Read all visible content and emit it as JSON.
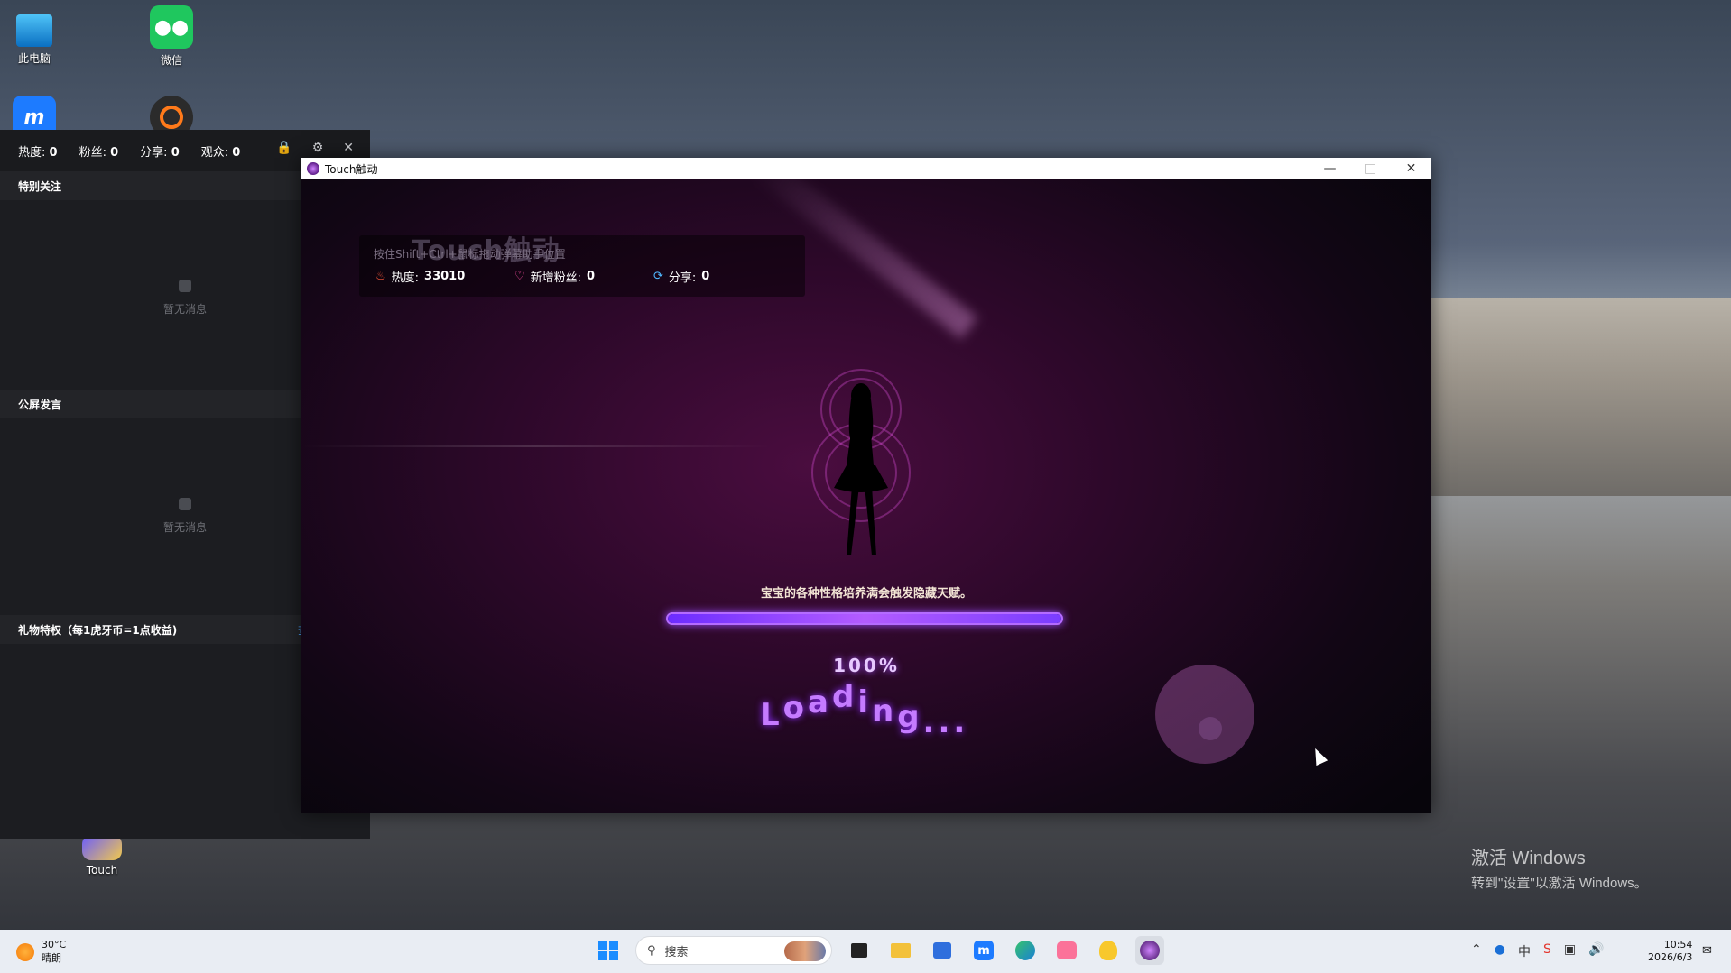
{
  "desktop": {
    "icons": [
      {
        "label": "此电脑",
        "icon": "computer-icon"
      },
      {
        "label": "微信",
        "icon": "wechat-icon"
      },
      {
        "label": "",
        "icon": "app-m-icon"
      },
      {
        "label": "",
        "icon": "record-icon"
      },
      {
        "label": "Touch",
        "icon": "touch-game-icon"
      }
    ],
    "activation": {
      "line1": "激活 Windows",
      "line2": "转到\"设置\"以激活 Windows。"
    }
  },
  "panel": {
    "stats": [
      {
        "label": "热度:",
        "value": "0"
      },
      {
        "label": "粉丝:",
        "value": "0"
      },
      {
        "label": "分享:",
        "value": "0"
      },
      {
        "label": "观众:",
        "value": "0"
      }
    ],
    "controls": [
      "lock-icon",
      "settings-icon",
      "close-icon"
    ],
    "sections": [
      {
        "title": "特别关注",
        "empty_text": "暂无消息"
      },
      {
        "title": "公屏发言",
        "empty_text": "暂无消息"
      },
      {
        "title": "礼物特权（每1虎牙币=1点收益)",
        "link": "查看"
      }
    ]
  },
  "window": {
    "title": "Touch触动",
    "hud": {
      "hint": "按住Shift+Ctrl+鼠标拖动弹幕助手位置",
      "logo": "Touch触动",
      "heat_label": "热度:",
      "heat_value": "33010",
      "fans_label": "新增粉丝:",
      "fans_value": "0",
      "share_label": "分享:",
      "share_value": "0"
    },
    "loading": {
      "caption": "宝宝的各种性格培养满会触发隐藏天赋。",
      "progress": 1.0,
      "percent_text": "100%",
      "text": "Loading..."
    }
  },
  "taskbar": {
    "weather_temp": "30°C",
    "weather_desc": "晴朗",
    "search_placeholder": "搜索",
    "apps": [
      "windows-start-icon",
      "task-view-icon",
      "file-explorer-icon",
      "store-icon",
      "app-m-icon",
      "edge-icon",
      "bilibili-icon",
      "qq-icon",
      "touch-app-icon"
    ],
    "tray": [
      "chevron-up-icon",
      "mic-icon",
      "ime-icon",
      "antivirus-icon",
      "network-icon",
      "volume-icon"
    ],
    "ime_label": "中",
    "time": "10:54",
    "date": "2026/6/3"
  }
}
